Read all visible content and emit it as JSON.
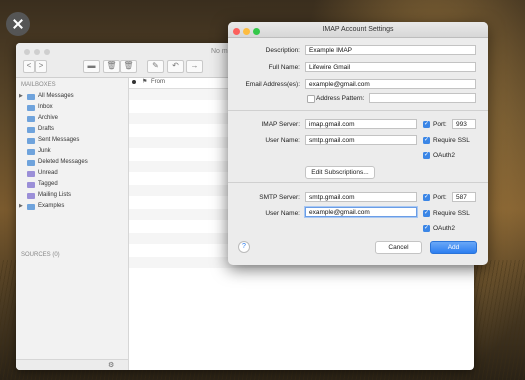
{
  "mail": {
    "title_partial": "No m",
    "nav_back": "<",
    "nav_forward": ">",
    "mailboxes_header": "MAILBOXES",
    "mailboxes": [
      {
        "label": "All Messages",
        "icon": "folder-icon",
        "expandable": true
      },
      {
        "label": "Inbox",
        "icon": "folder-icon"
      },
      {
        "label": "Archive",
        "icon": "folder-icon"
      },
      {
        "label": "Drafts",
        "icon": "folder-icon"
      },
      {
        "label": "Sent Messages",
        "icon": "folder-icon"
      },
      {
        "label": "Junk",
        "icon": "folder-icon"
      },
      {
        "label": "Deleted Messages",
        "icon": "folder-icon"
      },
      {
        "label": "Unread",
        "icon": "smart-folder-icon"
      },
      {
        "label": "Tagged",
        "icon": "smart-folder-icon"
      },
      {
        "label": "Mailing Lists",
        "icon": "smart-folder-icon"
      },
      {
        "label": "Examples",
        "icon": "folder-icon",
        "expandable": true
      }
    ],
    "sources_header": "SOURCES (0)",
    "list_header_from": "From"
  },
  "dialog": {
    "title": "IMAP Account Settings",
    "description_label": "Description:",
    "description_value": "Example IMAP",
    "fullname_label": "Full Name:",
    "fullname_value": "Lifewire Gmail",
    "email_label": "Email Address(es):",
    "email_value": "example@gmail.com",
    "address_pattern_label": "Address Pattern:",
    "imap_server_label": "IMAP Server:",
    "imap_server_value": "imap.gmail.com",
    "imap_username_label": "User Name:",
    "imap_username_value": "smtp.gmail.com",
    "port_label": "Port:",
    "imap_port_value": "993",
    "require_ssl_label": "Require SSL",
    "oauth2_label": "OAuth2",
    "edit_subscriptions_label": "Edit Subscriptions...",
    "smtp_server_label": "SMTP Server:",
    "smtp_server_value": "smtp.gmail.com",
    "smtp_username_label": "User Name:",
    "smtp_username_value": "example@gmail.com",
    "smtp_port_value": "587",
    "help_label": "?",
    "cancel_label": "Cancel",
    "add_label": "Add"
  },
  "colors": {
    "accent": "#2d7ef0",
    "close_red": "#fc605c",
    "minimize_yellow": "#fdbc40",
    "zoom_green": "#34c84a"
  }
}
